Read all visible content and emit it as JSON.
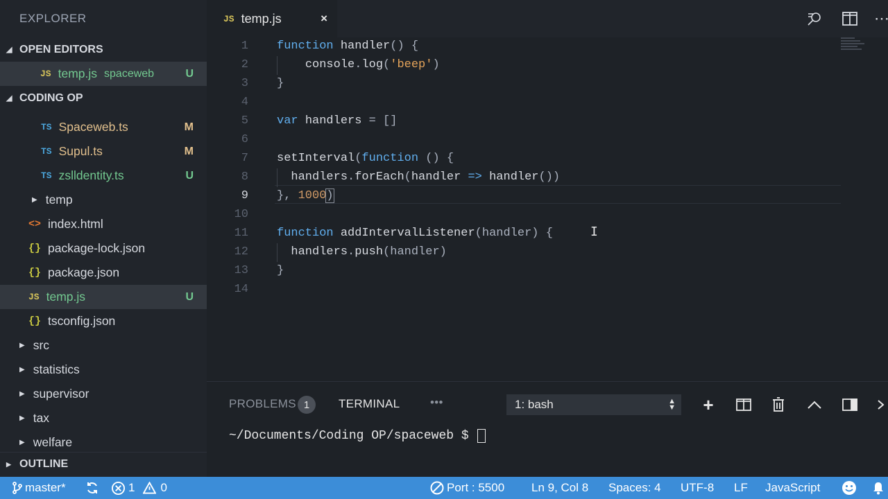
{
  "sidebar": {
    "title": "EXPLORER",
    "open_editors": {
      "label": "OPEN EDITORS",
      "items": [
        {
          "icon": "JS",
          "name": "temp.js",
          "folder": "spaceweb",
          "status": "U"
        }
      ]
    },
    "project": {
      "label": "CODING OP",
      "files": [
        {
          "icon": "TS",
          "name": "Spaceweb.ts",
          "status": "M"
        },
        {
          "icon": "TS",
          "name": "Supul.ts",
          "status": "M"
        },
        {
          "icon": "TS",
          "name": "zslldentity.ts",
          "status": "U"
        },
        {
          "icon": "",
          "name": "temp",
          "status": ""
        },
        {
          "icon": "<>",
          "name": "index.html",
          "status": ""
        },
        {
          "icon": "{}",
          "name": "package-lock.json",
          "status": ""
        },
        {
          "icon": "{}",
          "name": "package.json",
          "status": ""
        },
        {
          "icon": "JS",
          "name": "temp.js",
          "status": "U"
        },
        {
          "icon": "{}",
          "name": "tsconfig.json",
          "status": ""
        }
      ],
      "folders": [
        "src",
        "statistics",
        "supervisor",
        "tax",
        "welfare"
      ]
    },
    "outline": {
      "label": "OUTLINE"
    }
  },
  "tabs": [
    {
      "icon": "JS",
      "label": "temp.js",
      "close": "×"
    }
  ],
  "editor": {
    "line_numbers": [
      "1",
      "2",
      "3",
      "4",
      "5",
      "6",
      "7",
      "8",
      "9",
      "10",
      "11",
      "12",
      "13",
      "14"
    ],
    "current_line": "9",
    "lines": [
      [
        {
          "t": "kw",
          "v": "function "
        },
        {
          "t": "fn",
          "v": "handler"
        },
        {
          "t": "p",
          "v": "() {"
        }
      ],
      [
        {
          "t": "p",
          "v": "    "
        },
        {
          "t": "fn",
          "v": "console"
        },
        {
          "t": "p",
          "v": "."
        },
        {
          "t": "fn",
          "v": "log"
        },
        {
          "t": "p",
          "v": "("
        },
        {
          "t": "str",
          "v": "'beep'"
        },
        {
          "t": "p",
          "v": ")"
        }
      ],
      [
        {
          "t": "p",
          "v": "}"
        }
      ],
      [],
      [
        {
          "t": "kw",
          "v": "var "
        },
        {
          "t": "fn",
          "v": "handlers"
        },
        {
          "t": "p",
          "v": " = []"
        }
      ],
      [],
      [
        {
          "t": "fn",
          "v": "setInterval"
        },
        {
          "t": "p",
          "v": "("
        },
        {
          "t": "kw",
          "v": "function"
        },
        {
          "t": "p",
          "v": " () {"
        }
      ],
      [
        {
          "t": "p",
          "v": "  "
        },
        {
          "t": "fn",
          "v": "handlers"
        },
        {
          "t": "p",
          "v": "."
        },
        {
          "t": "fn",
          "v": "forEach"
        },
        {
          "t": "p",
          "v": "("
        },
        {
          "t": "fn",
          "v": "handler"
        },
        {
          "t": "kw",
          "v": " => "
        },
        {
          "t": "fn",
          "v": "handler"
        },
        {
          "t": "p",
          "v": "())"
        }
      ],
      [
        {
          "t": "p",
          "v": "}, "
        },
        {
          "t": "num",
          "v": "1000"
        },
        {
          "t": "p",
          "v": ")"
        }
      ],
      [],
      [
        {
          "t": "kw",
          "v": "function "
        },
        {
          "t": "fn",
          "v": "addIntervalListener"
        },
        {
          "t": "p",
          "v": "(handler) {"
        }
      ],
      [
        {
          "t": "p",
          "v": "  "
        },
        {
          "t": "fn",
          "v": "handlers"
        },
        {
          "t": "p",
          "v": "."
        },
        {
          "t": "fn",
          "v": "push"
        },
        {
          "t": "p",
          "v": "(handler)"
        }
      ],
      [
        {
          "t": "p",
          "v": "}"
        }
      ],
      []
    ]
  },
  "panel": {
    "problems_label": "PROBLEMS",
    "problems_count": "1",
    "terminal_label": "TERMINAL",
    "more": "•••",
    "terminal_select": "1: bash",
    "prompt": "~/Documents/Coding OP/spaceweb $ "
  },
  "statusbar": {
    "branch": "master*",
    "errors": "1",
    "warnings": "0",
    "port": "Port : 5500",
    "position": "Ln 9, Col 8",
    "spaces": "Spaces: 4",
    "encoding": "UTF-8",
    "eol": "LF",
    "language": "JavaScript"
  },
  "colors": {
    "statusbar": "#3c8dd8",
    "sidebar": "#21252b",
    "editor": "#1e2227",
    "keyword": "#61afef",
    "string": "#e5a45a",
    "untracked": "#73c990",
    "modified": "#e2c08d"
  }
}
